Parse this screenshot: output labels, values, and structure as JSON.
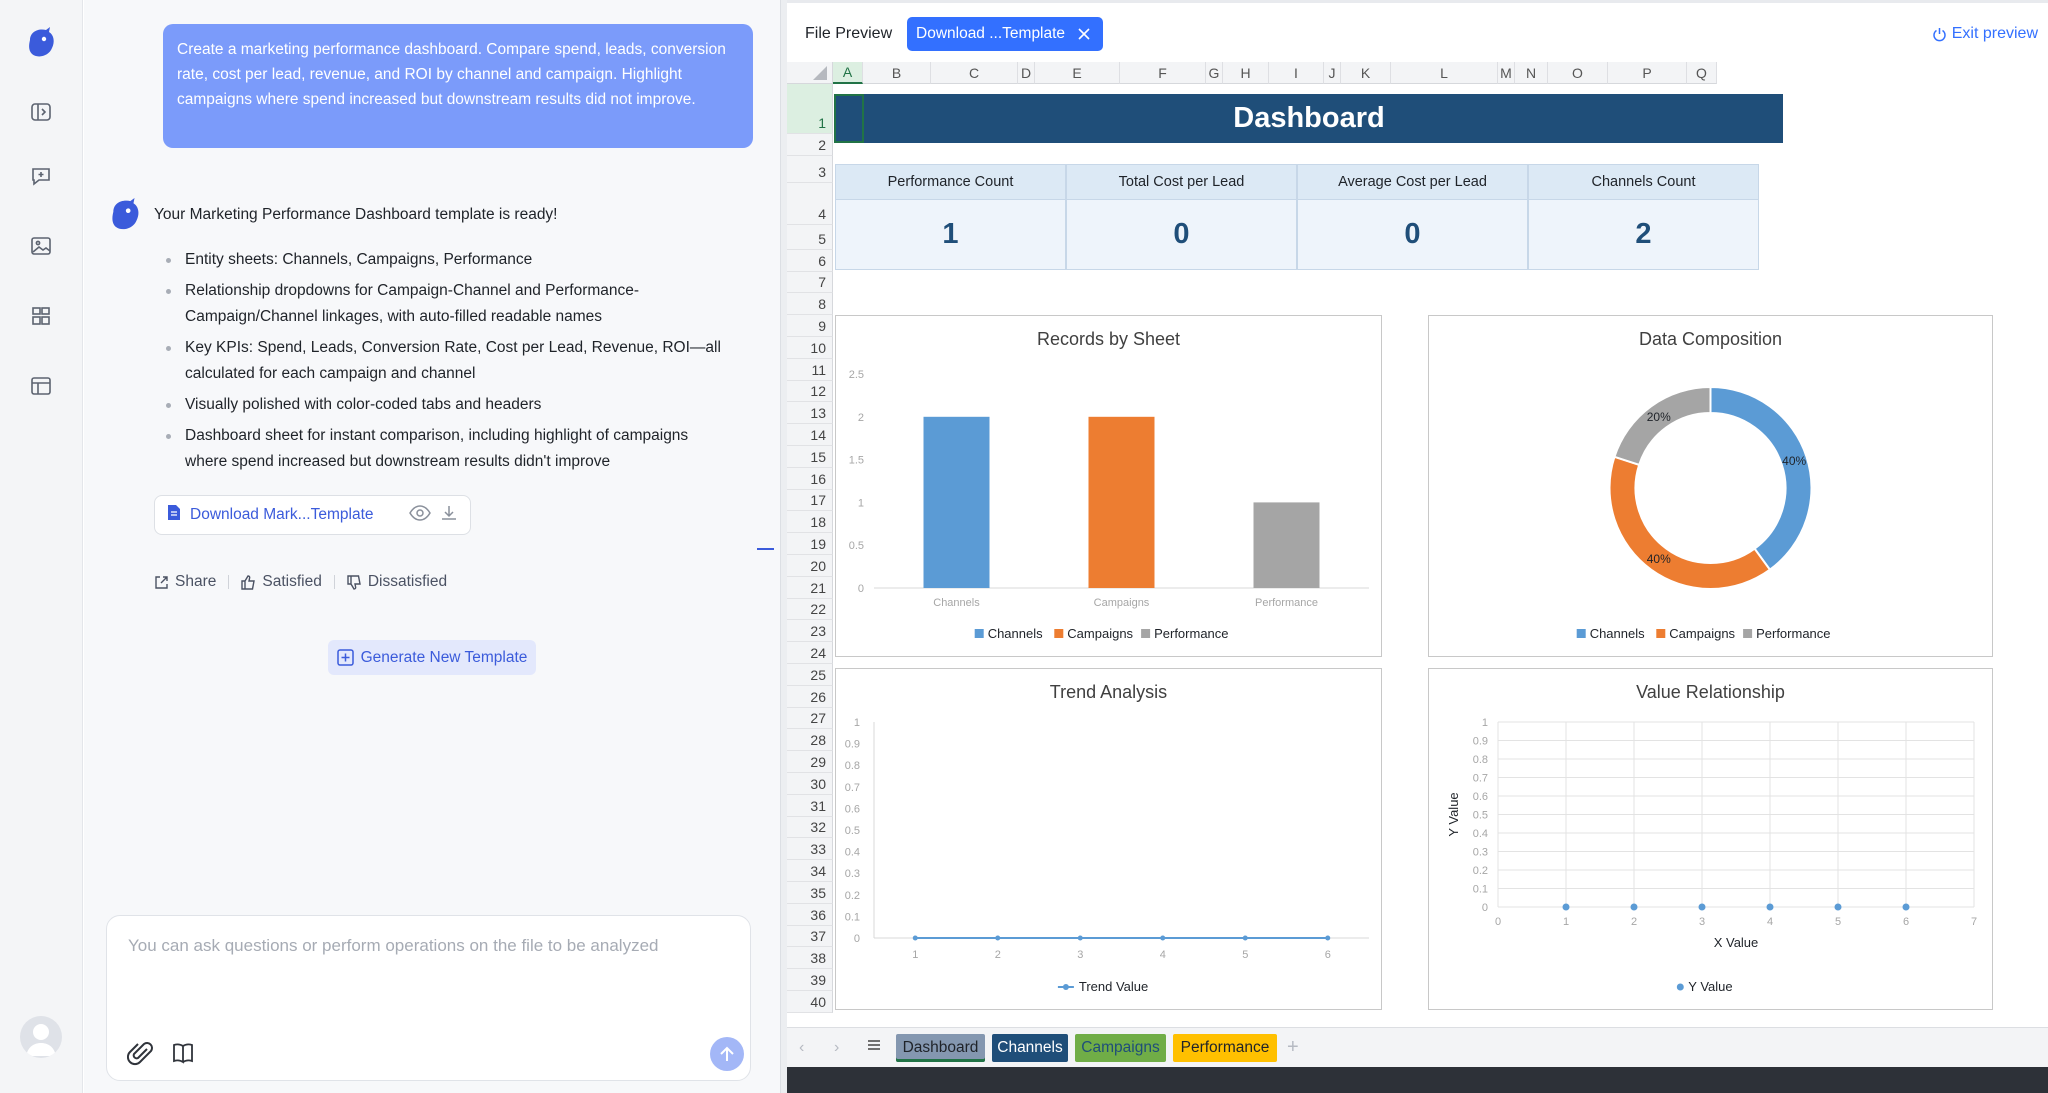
{
  "chat": {
    "user_message": "Create a marketing performance dashboard. Compare spend, leads, conversion rate, cost per lead, revenue, and ROI by channel and campaign. Highlight campaigns where spend increased but downstream results did not improve.",
    "bot_title": "Your Marketing Performance Dashboard template is ready!",
    "bot_points": [
      "Entity sheets: Channels, Campaigns, Performance",
      "Relationship dropdowns for Campaign-Channel and Performance-Campaign/Channel linkages, with auto-filled readable names",
      "Key KPIs: Spend, Leads, Conversion Rate, Cost per Lead, Revenue, ROI—all calculated for each campaign and channel",
      "Visually polished with color-coded tabs and headers",
      "Dashboard sheet for instant comparison, including highlight of campaigns where spend increased but downstream results didn't improve"
    ],
    "file_name": "Download Mark...Template",
    "share_label": "Share",
    "satisfied_label": "Satisfied",
    "dissatisfied_label": "Dissatisfied",
    "generate_label": "Generate New Template",
    "input_placeholder": "You can ask questions or perform operations on the file to be analyzed"
  },
  "preview": {
    "label": "File Preview",
    "tab_label": "Download ...Template",
    "exit_label": "Exit preview"
  },
  "sheet": {
    "columns": [
      "A",
      "B",
      "C",
      "D",
      "E",
      "F",
      "G",
      "H",
      "I",
      "J",
      "K",
      "L",
      "M",
      "N",
      "O",
      "P",
      "Q"
    ],
    "rows": [
      "1",
      "2",
      "3",
      "4",
      "5",
      "6",
      "7",
      "8",
      "9",
      "10",
      "11",
      "12",
      "13",
      "14",
      "15",
      "16",
      "17",
      "18",
      "19",
      "20",
      "21",
      "22",
      "23",
      "24",
      "25",
      "26",
      "27",
      "28",
      "29",
      "30",
      "31",
      "32",
      "33",
      "34",
      "35",
      "36",
      "37",
      "38",
      "39",
      "40"
    ],
    "title": "Dashboard",
    "kpis": [
      {
        "label": "Performance Count",
        "value": "1"
      },
      {
        "label": "Total Cost per Lead",
        "value": "0"
      },
      {
        "label": "Average Cost per Lead",
        "value": "0"
      },
      {
        "label": "Channels Count",
        "value": "2"
      }
    ],
    "tabs": [
      {
        "label": "Dashboard",
        "bg": "#8497b0",
        "fg": "#1f2329"
      },
      {
        "label": "Channels",
        "bg": "#1f4e79",
        "fg": "#ffffff"
      },
      {
        "label": "Campaigns",
        "bg": "#70ad47",
        "fg": "#1f4e79"
      },
      {
        "label": "Performance",
        "bg": "#ffc000",
        "fg": "#1f2329"
      }
    ]
  },
  "colors": {
    "blue": "#5b9bd5",
    "orange": "#ed7d31",
    "gray": "#a5a5a5",
    "accent": "#3370ff"
  },
  "chart_data": [
    {
      "type": "bar",
      "title": "Records by Sheet",
      "categories": [
        "Channels",
        "Campaigns",
        "Performance"
      ],
      "values": [
        2,
        2,
        1
      ],
      "yticks": [
        "0",
        "0.5",
        "1",
        "1.5",
        "2",
        "2.5"
      ],
      "ylim": [
        0,
        2.5
      ],
      "legend": [
        "Channels",
        "Campaigns",
        "Performance"
      ],
      "legend_position": "bottom"
    },
    {
      "type": "pie",
      "title": "Data Composition",
      "categories": [
        "Channels",
        "Campaigns",
        "Performance"
      ],
      "values": [
        40,
        40,
        20
      ],
      "labels": [
        "40%",
        "40%",
        "20%"
      ],
      "legend": [
        "Channels",
        "Campaigns",
        "Performance"
      ],
      "legend_position": "bottom"
    },
    {
      "type": "line",
      "title": "Trend Analysis",
      "x": [
        "1",
        "2",
        "3",
        "4",
        "5",
        "6"
      ],
      "values": [
        0,
        0,
        0,
        0,
        0,
        0
      ],
      "yticks": [
        "0",
        "0.1",
        "0.2",
        "0.3",
        "0.4",
        "0.5",
        "0.6",
        "0.7",
        "0.8",
        "0.9",
        "1"
      ],
      "ylim": [
        0,
        1
      ],
      "series_name": "Trend Value",
      "legend_position": "bottom"
    },
    {
      "type": "scatter",
      "title": "Value Relationship",
      "x": [
        1,
        2,
        3,
        4,
        5,
        6
      ],
      "values": [
        0,
        0,
        0,
        0,
        0,
        0
      ],
      "xticks": [
        "0",
        "1",
        "2",
        "3",
        "4",
        "5",
        "6",
        "7"
      ],
      "yticks": [
        "0",
        "0.1",
        "0.2",
        "0.3",
        "0.4",
        "0.5",
        "0.6",
        "0.7",
        "0.8",
        "0.9",
        "1"
      ],
      "xlim": [
        0,
        7
      ],
      "ylim": [
        0,
        1
      ],
      "xlabel": "X Value",
      "ylabel": "Y Value",
      "series_name": "Y Value",
      "grid": true,
      "legend_position": "bottom"
    }
  ]
}
